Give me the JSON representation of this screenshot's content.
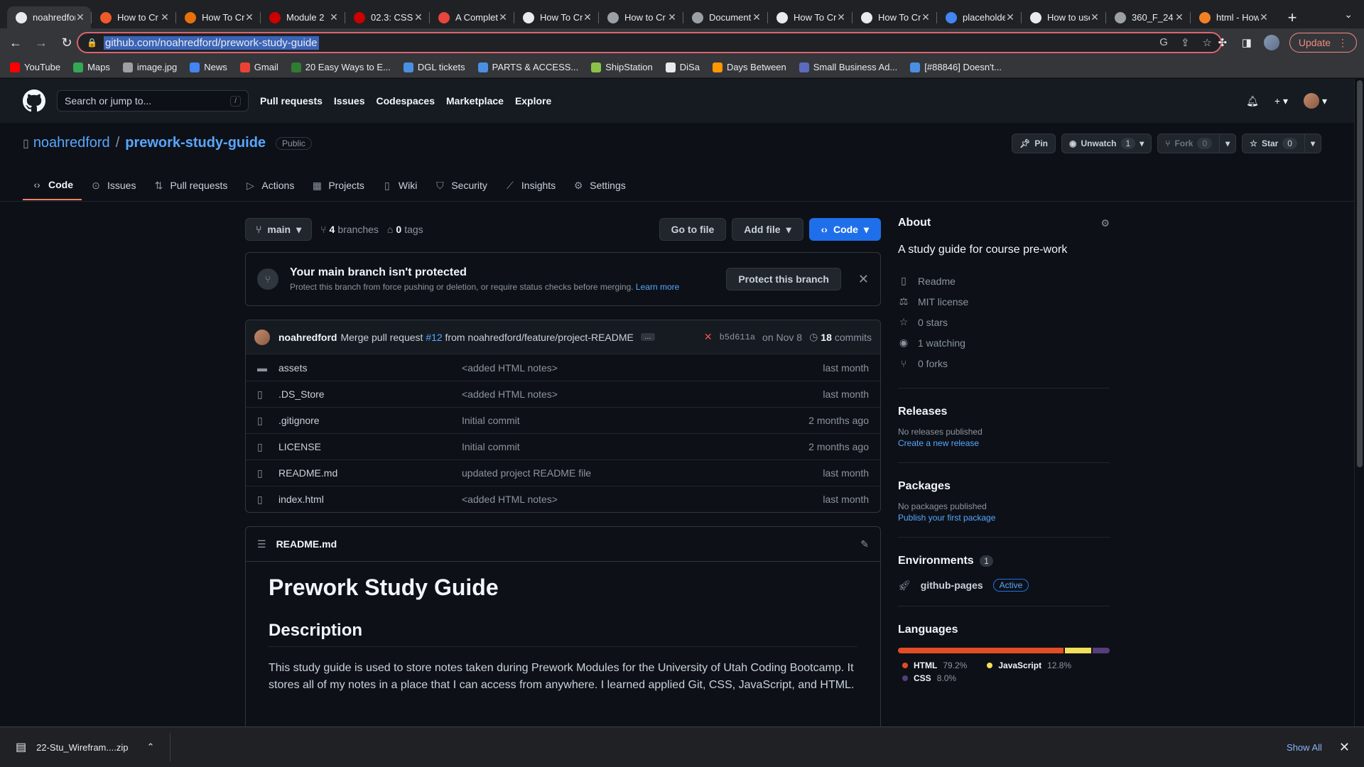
{
  "browser": {
    "tabs": [
      {
        "title": "noahredford/p",
        "color": "#e8eaed",
        "active": true
      },
      {
        "title": "How to Cr",
        "color": "#f05a28"
      },
      {
        "title": "How To Cr",
        "color": "#e8710a"
      },
      {
        "title": "Module 2",
        "color": "#cc0000"
      },
      {
        "title": "02.3: CSS",
        "color": "#cc0000"
      },
      {
        "title": "A Complete",
        "color": "#e8453c"
      },
      {
        "title": "How To Cr",
        "color": "#e8eaed"
      },
      {
        "title": "How to Cr",
        "color": "#9aa0a6"
      },
      {
        "title": "Document",
        "color": "#9aa0a6"
      },
      {
        "title": "How To Cr",
        "color": "#e8eaed"
      },
      {
        "title": "How To Cr",
        "color": "#e8eaed"
      },
      {
        "title": "placeholder",
        "color": "#4285f4"
      },
      {
        "title": "How to use",
        "color": "#e8eaed"
      },
      {
        "title": "360_F_24",
        "color": "#9aa0a6"
      },
      {
        "title": "html - How",
        "color": "#f48024"
      }
    ],
    "tab_close": "✕",
    "new_tab": "+",
    "url": "github.com/noahredford/prework-study-guide",
    "update_label": "Update",
    "bookmarks": [
      {
        "label": "YouTube",
        "color": "#ff0000"
      },
      {
        "label": "Maps",
        "color": "#34a853"
      },
      {
        "label": "image.jpg",
        "color": "#9aa0a6"
      },
      {
        "label": "News",
        "color": "#4285f4"
      },
      {
        "label": "Gmail",
        "color": "#ea4335"
      },
      {
        "label": "20 Easy Ways to E...",
        "color": "#2e7d32"
      },
      {
        "label": "DGL tickets",
        "color": "#4a90e2"
      },
      {
        "label": "PARTS & ACCESS...",
        "color": "#4a90e2"
      },
      {
        "label": "ShipStation",
        "color": "#8bc34a"
      },
      {
        "label": "DiSa",
        "color": "#e8eaed"
      },
      {
        "label": "Days Between",
        "color": "#ff9800"
      },
      {
        "label": "Small Business Ad...",
        "color": "#5c6bc0"
      },
      {
        "label": "[#88846] Doesn't...",
        "color": "#4a90e2"
      }
    ]
  },
  "github": {
    "search_placeholder": "Search or jump to...",
    "search_key": "/",
    "nav": [
      "Pull requests",
      "Issues",
      "Codespaces",
      "Marketplace",
      "Explore"
    ],
    "owner": "noahredford",
    "separator": "/",
    "repo": "prework-study-guide",
    "visibility": "Public",
    "actions": {
      "pin": "Pin",
      "unwatch": "Unwatch",
      "watch_count": "1",
      "fork": "Fork",
      "fork_count": "0",
      "star": "Star",
      "star_count": "0"
    },
    "repo_tabs": [
      {
        "label": "Code",
        "icon": "code-icon",
        "glyph": "‹›"
      },
      {
        "label": "Issues",
        "icon": "issue-icon",
        "glyph": "⊙"
      },
      {
        "label": "Pull requests",
        "icon": "pull-request-icon",
        "glyph": "⇅"
      },
      {
        "label": "Actions",
        "icon": "play-icon",
        "glyph": "▷"
      },
      {
        "label": "Projects",
        "icon": "table-icon",
        "glyph": "▦"
      },
      {
        "label": "Wiki",
        "icon": "book-icon",
        "glyph": "▯"
      },
      {
        "label": "Security",
        "icon": "shield-icon",
        "glyph": "⛉"
      },
      {
        "label": "Insights",
        "icon": "graph-icon",
        "glyph": "⟋"
      },
      {
        "label": "Settings",
        "icon": "gear-icon",
        "glyph": "⚙"
      }
    ]
  },
  "main": {
    "branch": "main",
    "branches_count": "4",
    "branches_label": "branches",
    "tags_count": "0",
    "tags_label": "tags",
    "go_to_file": "Go to file",
    "add_file": "Add file",
    "code_button": "Code",
    "protect": {
      "title": "Your main branch isn't protected",
      "desc": "Protect this branch from force pushing or deletion, or require status checks before merging.",
      "learn_more": "Learn more",
      "button": "Protect this branch"
    },
    "commit": {
      "author": "noahredford",
      "msg_prefix": "Merge pull request",
      "pr": "#12",
      "msg_suffix": "from noahredford/feature/project-README",
      "more": "…",
      "sha": "b5d611a",
      "date": "on Nov 8",
      "count": "18",
      "count_label": "commits"
    },
    "files": [
      {
        "name": "assets",
        "type": "folder",
        "msg": "<added HTML notes>",
        "age": "last month"
      },
      {
        "name": ".DS_Store",
        "type": "file",
        "msg": "<added HTML notes>",
        "age": "last month"
      },
      {
        "name": ".gitignore",
        "type": "file",
        "msg": "Initial commit",
        "age": "2 months ago"
      },
      {
        "name": "LICENSE",
        "type": "file",
        "msg": "Initial commit",
        "age": "2 months ago"
      },
      {
        "name": "README.md",
        "type": "file",
        "msg": "updated project README file",
        "age": "last month"
      },
      {
        "name": "index.html",
        "type": "file",
        "msg": "<added HTML notes>",
        "age": "last month"
      }
    ],
    "readme": {
      "filename": "README.md",
      "h1": "Prework Study Guide",
      "h2": "Description",
      "p": "This study guide is used to store notes taken during Prework Modules for the University of Utah Coding Bootcamp. It stores all of my notes in a place that I can access from anywhere. I learned applied Git, CSS, JavaScript, and HTML."
    }
  },
  "sidebar": {
    "about_title": "About",
    "about_desc": "A study guide for course pre-work",
    "about_items": [
      {
        "label": "Readme",
        "icon": "book-icon",
        "glyph": "▯"
      },
      {
        "label": "MIT license",
        "icon": "law-icon",
        "glyph": "⚖"
      },
      {
        "label": "0 stars",
        "icon": "star-icon",
        "glyph": "☆"
      },
      {
        "label": "1 watching",
        "icon": "eye-icon",
        "glyph": "◉"
      },
      {
        "label": "0 forks",
        "icon": "fork-icon",
        "glyph": "⑂"
      }
    ],
    "releases_title": "Releases",
    "releases_none": "No releases published",
    "releases_link": "Create a new release",
    "packages_title": "Packages",
    "packages_none": "No packages published",
    "packages_link": "Publish your first package",
    "environments_title": "Environments",
    "environments_count": "1",
    "env_name": "github-pages",
    "env_status": "Active",
    "languages_title": "Languages",
    "languages": [
      {
        "name": "HTML",
        "pct": "79.2%",
        "value": 79.2,
        "color": "#e34c26"
      },
      {
        "name": "JavaScript",
        "pct": "12.8%",
        "value": 12.8,
        "color": "#f1e05a"
      },
      {
        "name": "CSS",
        "pct": "8.0%",
        "value": 8.0,
        "color": "#563d7c"
      }
    ]
  },
  "downloads": {
    "file": "22-Stu_Wirefram....zip",
    "show_all": "Show All"
  }
}
